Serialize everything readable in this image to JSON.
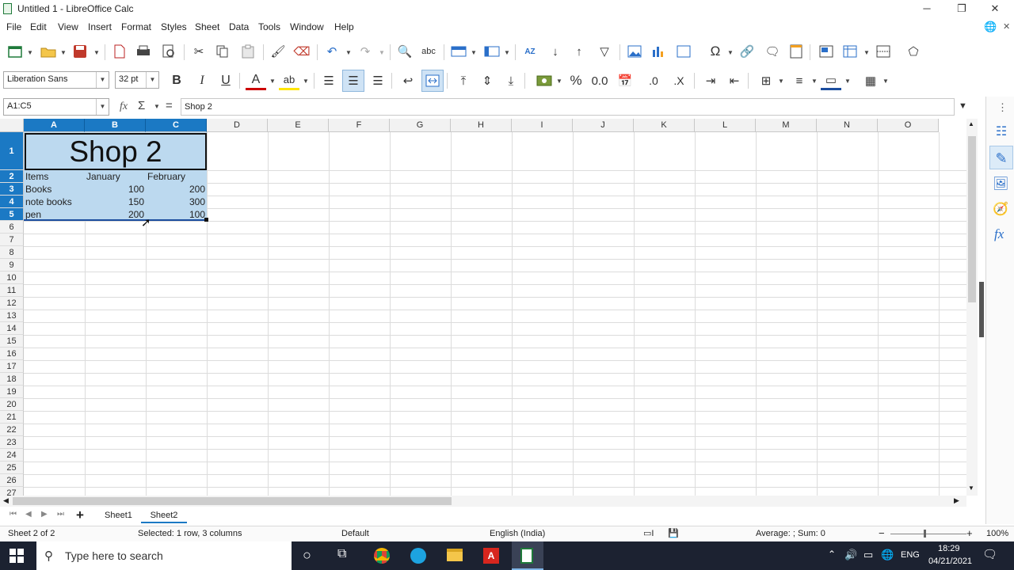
{
  "window": {
    "title": "Untitled 1 - LibreOffice Calc",
    "minimize": "─",
    "restore": "❐",
    "close": "✕"
  },
  "menu": [
    "File",
    "Edit",
    "View",
    "Insert",
    "Format",
    "Styles",
    "Sheet",
    "Data",
    "Tools",
    "Window",
    "Help"
  ],
  "font": {
    "name": "Liberation Sans",
    "size": "32 pt"
  },
  "formula_bar": {
    "name_box": "A1:C5",
    "fx": "fx",
    "sigma": "Σ",
    "equals": "=",
    "content": "Shop 2"
  },
  "columns": [
    "A",
    "B",
    "C",
    "D",
    "E",
    "F",
    "G",
    "H",
    "I",
    "J",
    "K",
    "L",
    "M",
    "N",
    "O"
  ],
  "rows": [
    "1",
    "2",
    "3",
    "4",
    "5",
    "6",
    "7",
    "8",
    "9",
    "10",
    "11",
    "12",
    "13",
    "14",
    "15",
    "16",
    "17",
    "18",
    "19",
    "20",
    "21",
    "22",
    "23",
    "24",
    "25",
    "26",
    "27"
  ],
  "sheet": {
    "title": "Shop 2",
    "headers": [
      "Items",
      "January",
      "February"
    ],
    "data": [
      [
        "Books",
        "100",
        "200"
      ],
      [
        "note books",
        "150",
        "300"
      ],
      [
        "pen",
        "200",
        "100"
      ]
    ]
  },
  "tabs": {
    "add": "+",
    "sheets": [
      "Sheet1",
      "Sheet2"
    ],
    "active": "Sheet2"
  },
  "status": {
    "sheet": "Sheet 2 of 2",
    "selection": "Selected: 1 row, 3 columns",
    "style": "Default",
    "language": "English (India)",
    "sum": "Average: ; Sum: 0",
    "zoom": "100%"
  },
  "taskbar": {
    "search_placeholder": "Type here to search",
    "lang": "ENG",
    "time": "18:29",
    "date": "04/21/2021"
  },
  "colors": {
    "selection_header": "#1b79c4",
    "selection_fill": "#bcd9ef",
    "taskbar": "#1c2231"
  }
}
